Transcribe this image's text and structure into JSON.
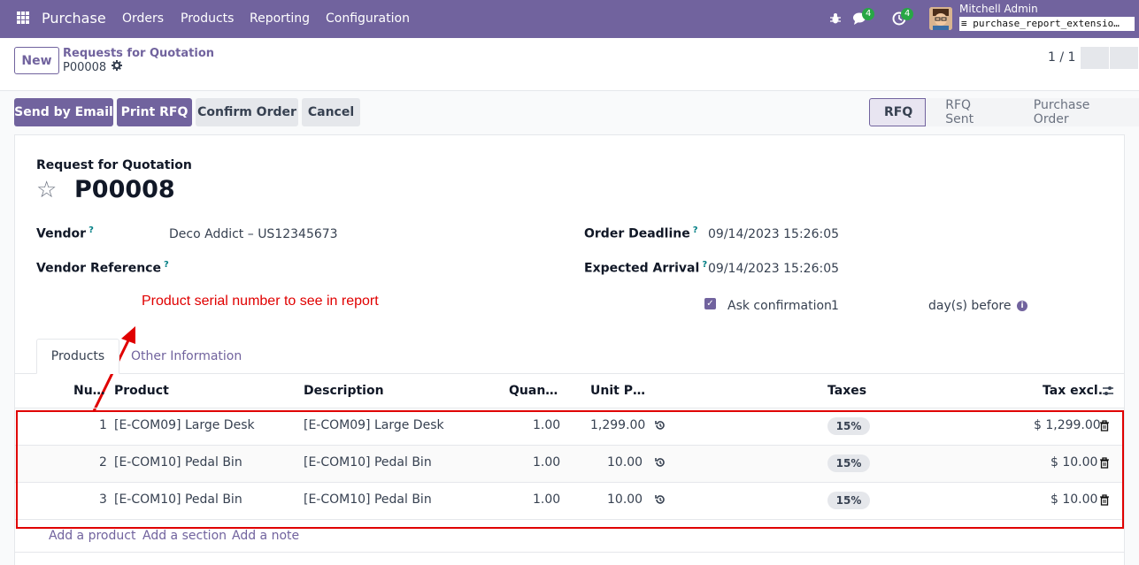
{
  "navbar": {
    "app_name": "Purchase",
    "menus": [
      "Orders",
      "Products",
      "Reporting",
      "Configuration"
    ],
    "chat_count": "4",
    "activity_count": "4",
    "user_name": "Mitchell Admin",
    "database": "purchase_report_extensio…"
  },
  "control_panel": {
    "new_label": "New",
    "breadcrumb_parent": "Requests for Quotation",
    "breadcrumb_current": "P00008",
    "pager": "1 / 1"
  },
  "actions": {
    "send_email": "Send by Email",
    "print_rfq": "Print RFQ",
    "confirm_order": "Confirm Order",
    "cancel": "Cancel"
  },
  "statusbar": {
    "stages": [
      "RFQ",
      "RFQ Sent",
      "Purchase Order"
    ],
    "active": "RFQ"
  },
  "form": {
    "subtitle": "Request for Quotation",
    "title": "P00008",
    "vendor_label": "Vendor",
    "vendor_value": "Deco Addict – US12345673",
    "vendor_ref_label": "Vendor Reference",
    "order_deadline_label": "Order Deadline",
    "order_deadline_value": "09/14/2023 15:26:05",
    "expected_arrival_label": "Expected Arrival",
    "expected_arrival_value": "09/14/2023 15:26:05",
    "ask_confirmation_label": "Ask confirmation",
    "ask_confirmation_days": "1",
    "days_before_label": "day(s) before",
    "help_mark": "?"
  },
  "annotation": "Product serial number to see in report",
  "tabs": [
    "Products",
    "Other Information"
  ],
  "table": {
    "headers": {
      "number": "Nu…",
      "product": "Product",
      "description": "Description",
      "quantity": "Quan…",
      "unit_price": "Unit P…",
      "taxes": "Taxes",
      "tax_excl": "Tax excl."
    },
    "rows": [
      {
        "number": "1",
        "product": "[E-COM09] Large Desk",
        "description": "[E-COM09] Large Desk",
        "quantity": "1.00",
        "unit_price": "1,299.00",
        "tax": "15%",
        "subtotal": "$ 1,299.00"
      },
      {
        "number": "2",
        "product": "[E-COM10] Pedal Bin",
        "description": "[E-COM10] Pedal Bin",
        "quantity": "1.00",
        "unit_price": "10.00",
        "tax": "15%",
        "subtotal": "$ 10.00"
      },
      {
        "number": "3",
        "product": "[E-COM10] Pedal Bin",
        "description": "[E-COM10] Pedal Bin",
        "quantity": "1.00",
        "unit_price": "10.00",
        "tax": "15%",
        "subtotal": "$ 10.00"
      }
    ],
    "add_product": "Add a product",
    "add_section": "Add a section",
    "add_note": "Add a note"
  },
  "colors": {
    "brand": "#71639e",
    "annotation": "#e00000",
    "badge": "#28a745"
  }
}
